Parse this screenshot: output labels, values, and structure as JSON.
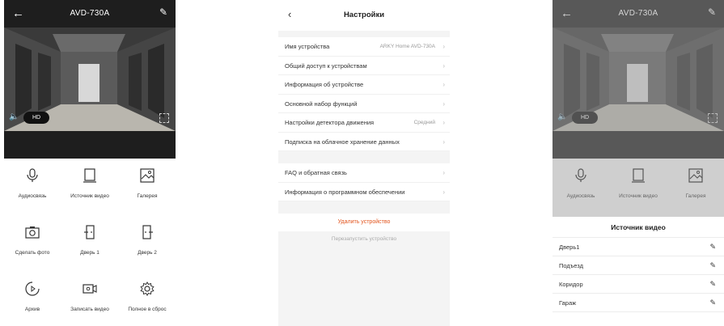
{
  "screen_main": {
    "title": "AVD-730A",
    "hd_label": "HD",
    "functions": [
      {
        "label": "Аудиосвязь",
        "icon": "microphone-icon"
      },
      {
        "label": "Источник видео",
        "icon": "video-source-icon"
      },
      {
        "label": "Галерея",
        "icon": "gallery-icon"
      },
      {
        "label": "Сделать фото",
        "icon": "camera-icon"
      },
      {
        "label": "Дверь 1",
        "icon": "door-icon"
      },
      {
        "label": "Дверь 2",
        "icon": "door-icon"
      },
      {
        "label": "Архив",
        "icon": "archive-icon"
      },
      {
        "label": "Записать видео",
        "icon": "record-video-icon"
      },
      {
        "label": "Полное в сброс",
        "icon": "gear-icon"
      }
    ]
  },
  "screen_settings": {
    "title": "Настройки",
    "group1": [
      {
        "label": "Имя устройства",
        "value": "ARKY Home AVD-730A"
      },
      {
        "label": "Общий доступ к устройствам",
        "value": ""
      },
      {
        "label": "Информация об устройстве",
        "value": ""
      },
      {
        "label": "Основной набор функций",
        "value": ""
      },
      {
        "label": "Настройки детектора движения",
        "value": "Средний"
      },
      {
        "label": "Подписка на облачное хранение данных",
        "value": ""
      }
    ],
    "group2": [
      {
        "label": "FAQ и обратная связь",
        "value": ""
      },
      {
        "label": "Информация о программном обеспечении",
        "value": ""
      }
    ],
    "delete_label": "Удалить устройство",
    "restart_label": "Перезапустить устройство"
  },
  "screen_source": {
    "title": "AVD-730A",
    "hd_label": "HD",
    "functions": [
      {
        "label": "Аудиосвязь",
        "icon": "microphone-icon"
      },
      {
        "label": "Источник видео",
        "icon": "video-source-icon"
      },
      {
        "label": "Галерея",
        "icon": "gallery-icon"
      }
    ],
    "sheet_title": "Источник видео",
    "sources": [
      "Дверь1",
      "Подъезд",
      "Коридор",
      "Гараж"
    ]
  }
}
